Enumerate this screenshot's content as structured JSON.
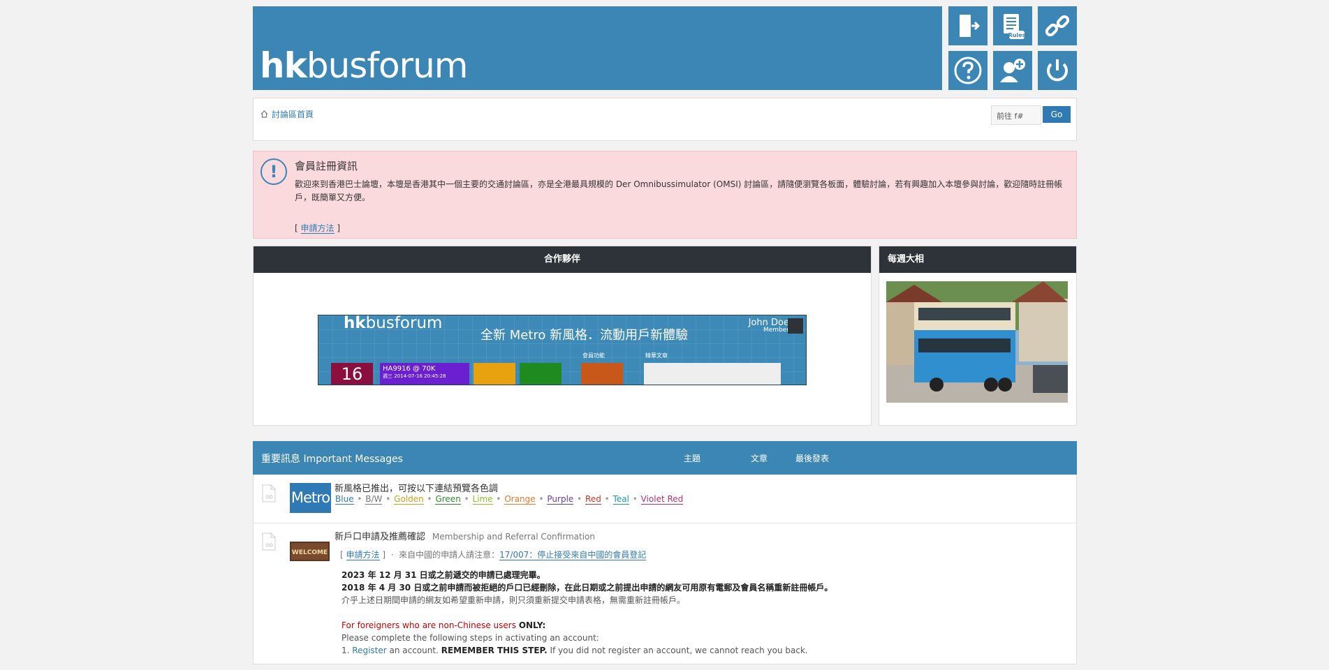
{
  "header": {
    "logo_bold": "hk",
    "logo_rest": "busforum",
    "tiles": [
      {
        "icon": "login-door-icon"
      },
      {
        "icon": "rules-icon",
        "label": "Rules"
      },
      {
        "icon": "link-icon"
      },
      {
        "icon": "help-icon"
      },
      {
        "icon": "add-user-icon"
      },
      {
        "icon": "power-icon"
      }
    ]
  },
  "breadcrumb": {
    "home_label": "討論區首頁",
    "jump_placeholder": "前往 f#",
    "go_label": "Go"
  },
  "notice": {
    "title": "會員註冊資訊",
    "body": "歡迎來到香港巴士論壇，本壇是香港其中一個主要的交通討論區，亦是全港最具規模的 Der Omnibussimulator (OMSI) 討論區，請隨便瀏覽各板面，體驗討論，若有興趣加入本壇參與討論，歡迎隨時註冊帳戶，既簡單又方便。",
    "apply_prefix": "[",
    "apply_link": "申請方法",
    "apply_suffix": "]"
  },
  "partners": {
    "title": "合作夥伴",
    "banner": {
      "logo_bold": "hk",
      "logo_rest": "busforum",
      "headline": "全新 Metro 新風格．流動用戶新體驗",
      "user_name": "John Doe",
      "user_role": "Member",
      "tile_date": "16",
      "tile_post_title": "HA9916 @ 70K",
      "tile_post_time": "週三 2014-07-16 20:45:28",
      "section_member": "會員功能",
      "section_featured": "精華文章"
    }
  },
  "weekly": {
    "title": "每週大相"
  },
  "important": {
    "title": "重要訊息 Important Messages",
    "col_topics": "主題",
    "col_posts": "文章",
    "col_last": "最後發表",
    "topic1": {
      "badge": "Metro",
      "title": "新風格已推出，可按以下連結預覽各色調",
      "colors": [
        {
          "label": "Blue",
          "color": "#2f7ab5"
        },
        {
          "label": "B/W",
          "color": "#555555"
        },
        {
          "label": "Golden",
          "color": "#c9a021"
        },
        {
          "label": "Green",
          "color": "#2c8a2c"
        },
        {
          "label": "Lime",
          "color": "#8cbf26"
        },
        {
          "label": "Orange",
          "color": "#e8782a"
        },
        {
          "label": "Purple",
          "color": "#6a3d9a"
        },
        {
          "label": "Red",
          "color": "#c0392b"
        },
        {
          "label": "Teal",
          "color": "#1f9a9a"
        },
        {
          "label": "Violet Red",
          "color": "#b0337a"
        }
      ]
    },
    "topic2": {
      "badge": "WELCOME",
      "title": "新戶口申請及推薦確認",
      "subtitle": "Membership and Referral Confirmation",
      "link_open": "[",
      "link_apply": "申請方法",
      "link_close": "]",
      "separator": "·",
      "china_note": "來自中國的申請人請注意：",
      "china_link": "17/007：停止接受來自中國的會員登記",
      "line1": "2023 年 12 月 31 日或之前遞交的申請已處理完畢。",
      "line2": "2018 年 4 月 30 日或之前申請而被拒絕的戶口已經刪除，在此日期或之前提出申請的網友可用原有電郵及會員名稱重新註冊帳戶。",
      "line3": "介乎上述日期間申請的網友如希望重新申請，則只須重新提交申請表格，無需重新註冊帳戶。",
      "foreign_prefix": "For foreigners who are non-Chinese users ",
      "foreign_only": "ONLY:",
      "steps_intro": "Please complete the following steps in activating an account:",
      "step1_num": "1. ",
      "step1_link": "Register",
      "step1_a": " an account. ",
      "step1_bold": "REMEMBER THIS STEP.",
      "step1_b": " If you did not register an account, we cannot reach you back."
    }
  }
}
